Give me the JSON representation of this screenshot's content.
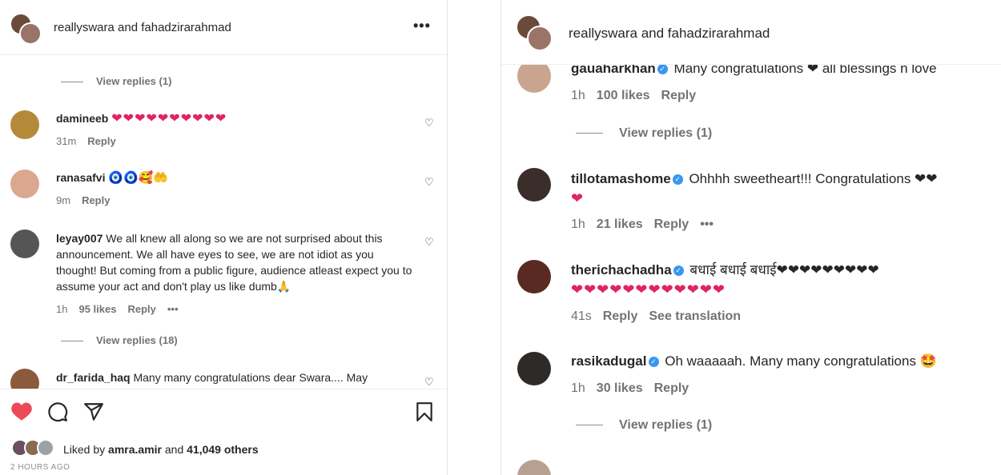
{
  "left": {
    "header": {
      "title": "reallyswara and fahadzirarahmad",
      "more": "•••"
    },
    "top_fragment_view_replies": "View replies (1)",
    "comments": [
      {
        "user": "damineeb",
        "text": "❤❤❤❤❤❤❤❤❤❤",
        "time": "31m",
        "likes": "",
        "reply": "Reply",
        "more": "",
        "avatar_color": "#b38a3a"
      },
      {
        "user": "ranasafvi",
        "text": "🧿🧿🥰🤲",
        "time": "9m",
        "likes": "",
        "reply": "Reply",
        "more": "",
        "avatar_color": "#d9a88e"
      },
      {
        "user": "leyay007",
        "text": "We all knew all along so we are not surprised about this announcement. We all have eyes to see, we are not idiot as you thought! But coming from a public figure, audience atleast expect you to assume your act and don't play us like dumb🙏",
        "time": "1h",
        "likes": "95 likes",
        "reply": "Reply",
        "more": "•••",
        "avatar_color": "#555555"
      }
    ],
    "view_replies_18": "View replies (18)",
    "partial_comment": {
      "user": "dr_farida_haq",
      "text": "Many many congratulations dear Swara.... May"
    },
    "footer": {
      "liked_prefix": "Liked by",
      "liked_user": "amra.amir",
      "liked_mid": "and",
      "liked_count": "41,049 others",
      "time_ago": "2 HOURS AGO"
    }
  },
  "right": {
    "header": {
      "title": "reallyswara and fahadzirarahmad"
    },
    "top_comment": {
      "user": "gauaharkhan",
      "text": "Many congratulations ❤ all blessings n love",
      "time": "1h",
      "likes": "100 likes",
      "reply": "Reply"
    },
    "view_replies_1a": "View replies (1)",
    "comments": [
      {
        "user": "tillotamashome",
        "text": "Ohhhh sweetheart!!! Congratulations ❤❤",
        "text2": "❤",
        "time": "1h",
        "likes": "21 likes",
        "reply": "Reply",
        "more": "•••"
      },
      {
        "user": "therichachadha",
        "text": "बधाई बधाई बधाई❤❤❤❤❤❤❤❤❤",
        "text2": "❤❤❤❤❤❤❤❤❤❤❤❤",
        "time": "41s",
        "likes": "",
        "reply": "Reply",
        "extra": "See translation"
      },
      {
        "user": "rasikadugal",
        "text": "Oh waaaaah. Many many congratulations 🤩",
        "time": "1h",
        "likes": "30 likes",
        "reply": "Reply"
      }
    ],
    "view_replies_1b": "View replies (1)"
  },
  "colors": {
    "heart_red": "#ed4956",
    "verified_blue": "#3897f0",
    "muted": "#737373"
  }
}
